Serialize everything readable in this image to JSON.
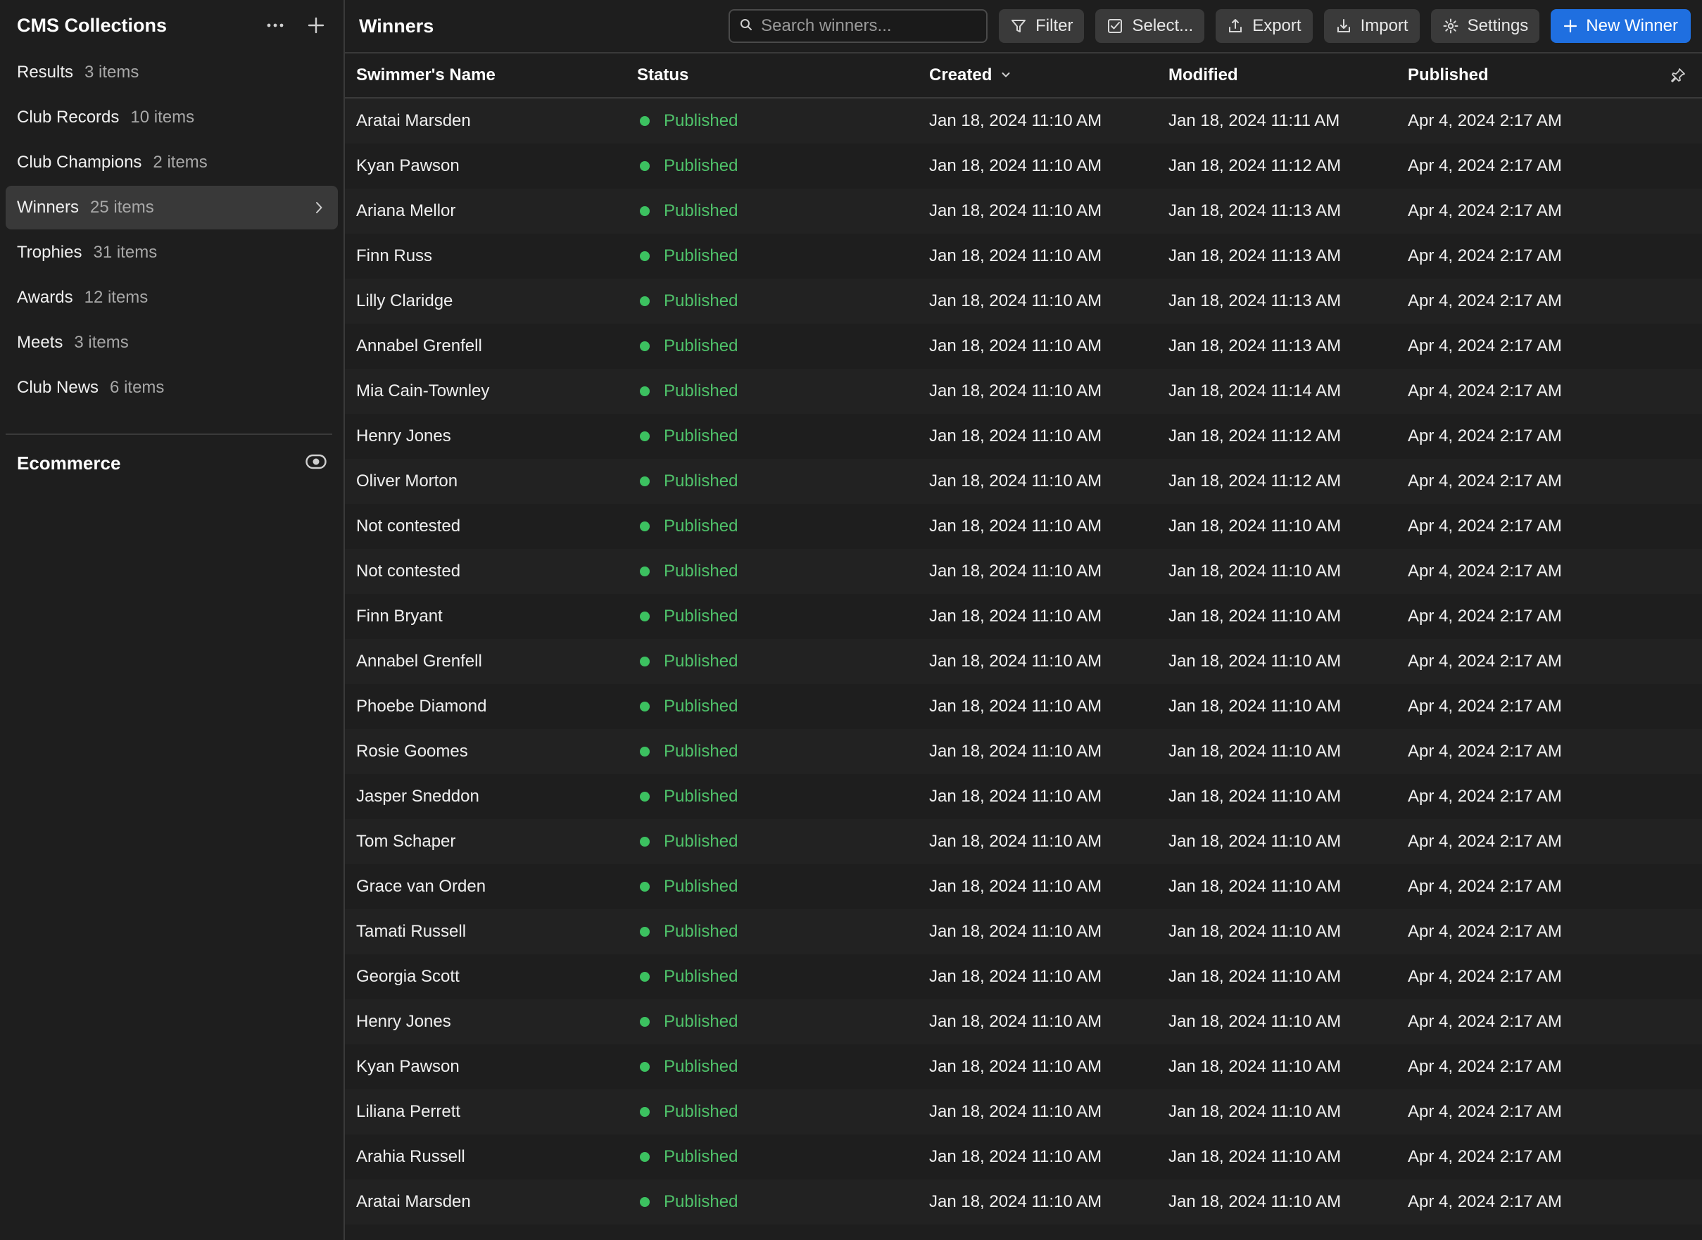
{
  "sidebar": {
    "title": "CMS Collections",
    "collections": [
      {
        "name": "Results",
        "count": "3 items"
      },
      {
        "name": "Club Records",
        "count": "10 items"
      },
      {
        "name": "Club Champions",
        "count": "2 items"
      },
      {
        "name": "Winners",
        "count": "25 items"
      },
      {
        "name": "Trophies",
        "count": "31 items"
      },
      {
        "name": "Awards",
        "count": "12 items"
      },
      {
        "name": "Meets",
        "count": "3 items"
      },
      {
        "name": "Club News",
        "count": "6 items"
      }
    ],
    "active_index": 3,
    "section_title": "Ecommerce"
  },
  "header": {
    "title": "Winners",
    "search_placeholder": "Search winners...",
    "filter_label": "Filter",
    "select_label": "Select...",
    "export_label": "Export",
    "import_label": "Import",
    "settings_label": "Settings",
    "new_label": "New Winner"
  },
  "table": {
    "columns": [
      "Swimmer's Name",
      "Status",
      "Created",
      "Modified",
      "Published"
    ],
    "rows": [
      [
        "Aratai Marsden",
        "Published",
        "Jan 18, 2024 11:10 AM",
        "Jan 18, 2024 11:11 AM",
        "Apr 4, 2024 2:17 AM"
      ],
      [
        "Kyan Pawson",
        "Published",
        "Jan 18, 2024 11:10 AM",
        "Jan 18, 2024 11:12 AM",
        "Apr 4, 2024 2:17 AM"
      ],
      [
        "Ariana Mellor",
        "Published",
        "Jan 18, 2024 11:10 AM",
        "Jan 18, 2024 11:13 AM",
        "Apr 4, 2024 2:17 AM"
      ],
      [
        "Finn Russ",
        "Published",
        "Jan 18, 2024 11:10 AM",
        "Jan 18, 2024 11:13 AM",
        "Apr 4, 2024 2:17 AM"
      ],
      [
        "Lilly Claridge",
        "Published",
        "Jan 18, 2024 11:10 AM",
        "Jan 18, 2024 11:13 AM",
        "Apr 4, 2024 2:17 AM"
      ],
      [
        "Annabel Grenfell",
        "Published",
        "Jan 18, 2024 11:10 AM",
        "Jan 18, 2024 11:13 AM",
        "Apr 4, 2024 2:17 AM"
      ],
      [
        "Mia Cain-Townley",
        "Published",
        "Jan 18, 2024 11:10 AM",
        "Jan 18, 2024 11:14 AM",
        "Apr 4, 2024 2:17 AM"
      ],
      [
        "Henry Jones",
        "Published",
        "Jan 18, 2024 11:10 AM",
        "Jan 18, 2024 11:12 AM",
        "Apr 4, 2024 2:17 AM"
      ],
      [
        "Oliver Morton",
        "Published",
        "Jan 18, 2024 11:10 AM",
        "Jan 18, 2024 11:12 AM",
        "Apr 4, 2024 2:17 AM"
      ],
      [
        "Not contested",
        "Published",
        "Jan 18, 2024 11:10 AM",
        "Jan 18, 2024 11:10 AM",
        "Apr 4, 2024 2:17 AM"
      ],
      [
        "Not contested",
        "Published",
        "Jan 18, 2024 11:10 AM",
        "Jan 18, 2024 11:10 AM",
        "Apr 4, 2024 2:17 AM"
      ],
      [
        "Finn Bryant",
        "Published",
        "Jan 18, 2024 11:10 AM",
        "Jan 18, 2024 11:10 AM",
        "Apr 4, 2024 2:17 AM"
      ],
      [
        "Annabel Grenfell",
        "Published",
        "Jan 18, 2024 11:10 AM",
        "Jan 18, 2024 11:10 AM",
        "Apr 4, 2024 2:17 AM"
      ],
      [
        "Phoebe Diamond",
        "Published",
        "Jan 18, 2024 11:10 AM",
        "Jan 18, 2024 11:10 AM",
        "Apr 4, 2024 2:17 AM"
      ],
      [
        "Rosie Goomes",
        "Published",
        "Jan 18, 2024 11:10 AM",
        "Jan 18, 2024 11:10 AM",
        "Apr 4, 2024 2:17 AM"
      ],
      [
        "Jasper Sneddon",
        "Published",
        "Jan 18, 2024 11:10 AM",
        "Jan 18, 2024 11:10 AM",
        "Apr 4, 2024 2:17 AM"
      ],
      [
        "Tom Schaper",
        "Published",
        "Jan 18, 2024 11:10 AM",
        "Jan 18, 2024 11:10 AM",
        "Apr 4, 2024 2:17 AM"
      ],
      [
        "Grace van Orden",
        "Published",
        "Jan 18, 2024 11:10 AM",
        "Jan 18, 2024 11:10 AM",
        "Apr 4, 2024 2:17 AM"
      ],
      [
        "Tamati Russell",
        "Published",
        "Jan 18, 2024 11:10 AM",
        "Jan 18, 2024 11:10 AM",
        "Apr 4, 2024 2:17 AM"
      ],
      [
        "Georgia Scott",
        "Published",
        "Jan 18, 2024 11:10 AM",
        "Jan 18, 2024 11:10 AM",
        "Apr 4, 2024 2:17 AM"
      ],
      [
        "Henry Jones",
        "Published",
        "Jan 18, 2024 11:10 AM",
        "Jan 18, 2024 11:10 AM",
        "Apr 4, 2024 2:17 AM"
      ],
      [
        "Kyan Pawson",
        "Published",
        "Jan 18, 2024 11:10 AM",
        "Jan 18, 2024 11:10 AM",
        "Apr 4, 2024 2:17 AM"
      ],
      [
        "Liliana Perrett",
        "Published",
        "Jan 18, 2024 11:10 AM",
        "Jan 18, 2024 11:10 AM",
        "Apr 4, 2024 2:17 AM"
      ],
      [
        "Arahia Russell",
        "Published",
        "Jan 18, 2024 11:10 AM",
        "Jan 18, 2024 11:10 AM",
        "Apr 4, 2024 2:17 AM"
      ],
      [
        "Aratai Marsden",
        "Published",
        "Jan 18, 2024 11:10 AM",
        "Jan 18, 2024 11:10 AM",
        "Apr 4, 2024 2:17 AM"
      ]
    ]
  },
  "icons": {
    "more": "more-horizontal-icon",
    "add": "plus-icon",
    "chevron": "chevron-right-icon",
    "toggle": "eye-toggle-icon",
    "search": "search-icon",
    "filter": "filter-icon",
    "select": "checkbox-icon",
    "export": "export-icon",
    "import": "import-icon",
    "settings": "gear-icon",
    "sort": "chevron-down-icon",
    "pin": "pin-icon"
  },
  "colors": {
    "background": "#1e1e1e",
    "active_item": "#393939",
    "primary": "#1f6fe0",
    "status_published": "#4fc26a"
  }
}
